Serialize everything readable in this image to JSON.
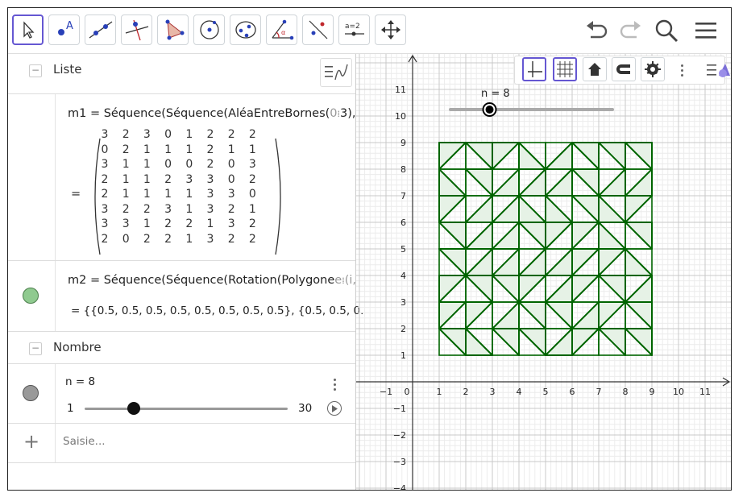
{
  "algebra": {
    "groups": {
      "liste": "Liste",
      "nombre": "Nombre"
    },
    "m1": {
      "definition_pre": "m1  =  Séquence(Séquence(AléaEntreBornes(",
      "definition_arg_a": "0",
      "definition_arg_b": "3),",
      "equals": "=",
      "matrix": [
        [
          "3",
          "2",
          "3",
          "0",
          "1",
          "2",
          "2",
          "2"
        ],
        [
          "0",
          "2",
          "1",
          "1",
          "1",
          "2",
          "1",
          "1"
        ],
        [
          "3",
          "1",
          "1",
          "0",
          "0",
          "2",
          "0",
          "3"
        ],
        [
          "2",
          "1",
          "1",
          "2",
          "3",
          "3",
          "0",
          "2"
        ],
        [
          "2",
          "1",
          "1",
          "1",
          "1",
          "3",
          "3",
          "0"
        ],
        [
          "3",
          "2",
          "2",
          "3",
          "1",
          "3",
          "2",
          "1"
        ],
        [
          "3",
          "3",
          "1",
          "2",
          "2",
          "1",
          "3",
          "2"
        ],
        [
          "2",
          "0",
          "2",
          "2",
          "1",
          "3",
          "2",
          "2"
        ]
      ]
    },
    "m2": {
      "definition_pre": "m2  =  Séquence(Séquence(Rotation(Polygone",
      "definition_tail": "(i,",
      "value": "=  {{0.5, 0.5, 0.5, 0.5, 0.5, 0.5, 0.5, 0.5}, {0.5, 0.5, 0."
    },
    "n": {
      "label": "n = 8",
      "min": "1",
      "max": "30",
      "value": 8
    },
    "input_placeholder": "Saisie..."
  },
  "graphics": {
    "slider_label": "n = 8",
    "x_ticks": [
      "−1",
      "0",
      "1",
      "2",
      "3",
      "4",
      "5",
      "6",
      "7",
      "8",
      "9",
      "10",
      "11"
    ],
    "y_ticks": [
      "11",
      "10",
      "9",
      "8",
      "7",
      "6",
      "5",
      "4",
      "3",
      "2",
      "1",
      "−1",
      "−2",
      "−3",
      "−4"
    ],
    "tile_color": "#006400",
    "tile_fill": "#e6f2e6"
  },
  "colors": {
    "accent": "#6557d2",
    "m2_marble": "#8fca8f",
    "n_marble": "#999999"
  }
}
